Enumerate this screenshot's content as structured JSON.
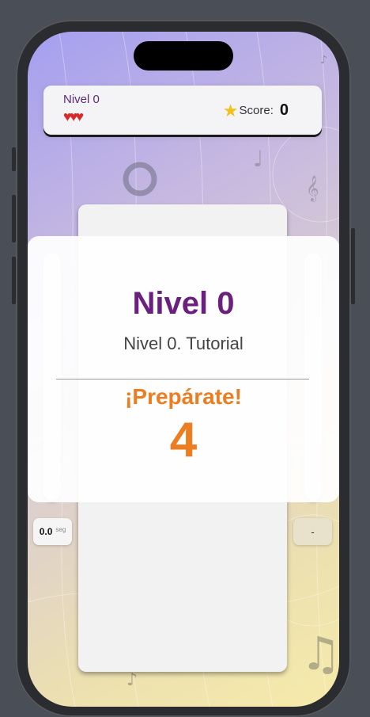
{
  "header": {
    "level_label": "Nivel 0",
    "hearts": "♥♥♥",
    "lives": 3,
    "score_label": "Score:",
    "score_value": "0"
  },
  "timer": {
    "value": "0.0",
    "unit": "seg"
  },
  "side_button": {
    "label": "-"
  },
  "overlay": {
    "title": "Nivel 0",
    "subtitle": "Nivel 0. Tutorial",
    "ready": "¡Prepárate!",
    "countdown": "4"
  },
  "colors": {
    "level_purple": "#6b1f7e",
    "countdown_orange": "#ec7d20",
    "star": "#f2c21b",
    "heart": "#d62b2b"
  },
  "icons": [
    "star-icon",
    "heart-icon",
    "music-note-icon"
  ]
}
